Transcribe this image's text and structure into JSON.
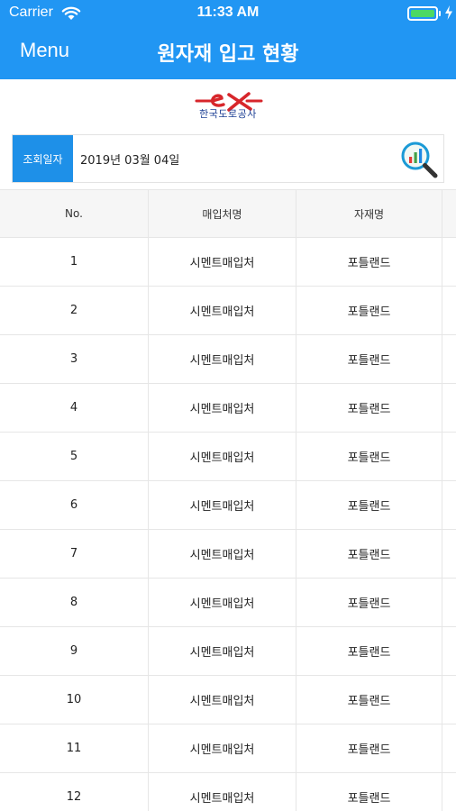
{
  "status_bar": {
    "carrier": "Carrier",
    "time": "11:33 AM",
    "battery_level": 1.0,
    "battery_color": "#4cd964"
  },
  "nav": {
    "menu_label": "Menu",
    "title": "원자재 입고 현황",
    "background_color": "#2196f3"
  },
  "logo": {
    "mark": "ex",
    "text": "한국도로공사",
    "mark_color": "#d7262b",
    "text_color": "#1c3f94"
  },
  "search": {
    "label": "조회일자",
    "date_value": "2019년 03월 04일",
    "button_icon": "chart-magnifier-icon",
    "label_color": "#1e90e8"
  },
  "table": {
    "columns": [
      "No.",
      "매입처명",
      "자재명"
    ],
    "rows": [
      {
        "no": "1",
        "supplier": "시멘트매입처",
        "material": "포틀랜드"
      },
      {
        "no": "2",
        "supplier": "시멘트매입처",
        "material": "포틀랜드"
      },
      {
        "no": "3",
        "supplier": "시멘트매입처",
        "material": "포틀랜드"
      },
      {
        "no": "4",
        "supplier": "시멘트매입처",
        "material": "포틀랜드"
      },
      {
        "no": "5",
        "supplier": "시멘트매입처",
        "material": "포틀랜드"
      },
      {
        "no": "6",
        "supplier": "시멘트매입처",
        "material": "포틀랜드"
      },
      {
        "no": "7",
        "supplier": "시멘트매입처",
        "material": "포틀랜드"
      },
      {
        "no": "8",
        "supplier": "시멘트매입처",
        "material": "포틀랜드"
      },
      {
        "no": "9",
        "supplier": "시멘트매입처",
        "material": "포틀랜드"
      },
      {
        "no": "10",
        "supplier": "시멘트매입처",
        "material": "포틀랜드"
      },
      {
        "no": "11",
        "supplier": "시멘트매입처",
        "material": "포틀랜드"
      },
      {
        "no": "12",
        "supplier": "시멘트매입처",
        "material": "포틀랜드"
      }
    ]
  }
}
